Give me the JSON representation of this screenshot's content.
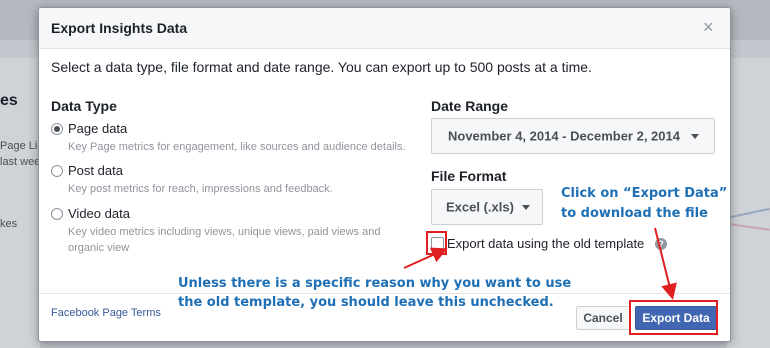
{
  "background": {
    "partial_title": "es",
    "partial_lines": [
      "Page Lik",
      "last wee",
      "kes"
    ]
  },
  "dialog": {
    "title": "Export Insights Data",
    "close_icon": "close-icon",
    "intro": "Select a data type, file format and date range. You can export up to 500 posts at a time.",
    "data_type": {
      "label": "Data Type",
      "options": [
        {
          "title": "Page data",
          "desc": "Key Page metrics for engagement, like sources and audience details.",
          "checked": true
        },
        {
          "title": "Post data",
          "desc": "Key post metrics for reach, impressions and feedback.",
          "checked": false
        },
        {
          "title": "Video data",
          "desc": "Key video metrics including views, unique views, paid views and organic view",
          "checked": false
        }
      ]
    },
    "date_range": {
      "label": "Date Range",
      "value": "November 4, 2014 - December 2, 2014"
    },
    "file_format": {
      "label": "File Format",
      "value": "Excel (.xls)"
    },
    "old_template": {
      "label": "Export data using the old template",
      "checked": false
    },
    "footer": {
      "terms": "Facebook Page Terms",
      "cancel": "Cancel",
      "export": "Export Data"
    }
  },
  "annotations": {
    "export_note_line1": "Click on “Export Data”",
    "export_note_line2": "to download the file",
    "template_note_line1": "Unless there is a specific reason why you want to use",
    "template_note_line2": "the old template, you should leave this unchecked.",
    "color": "#1f6fb5",
    "highlight_color": "#e02020"
  }
}
